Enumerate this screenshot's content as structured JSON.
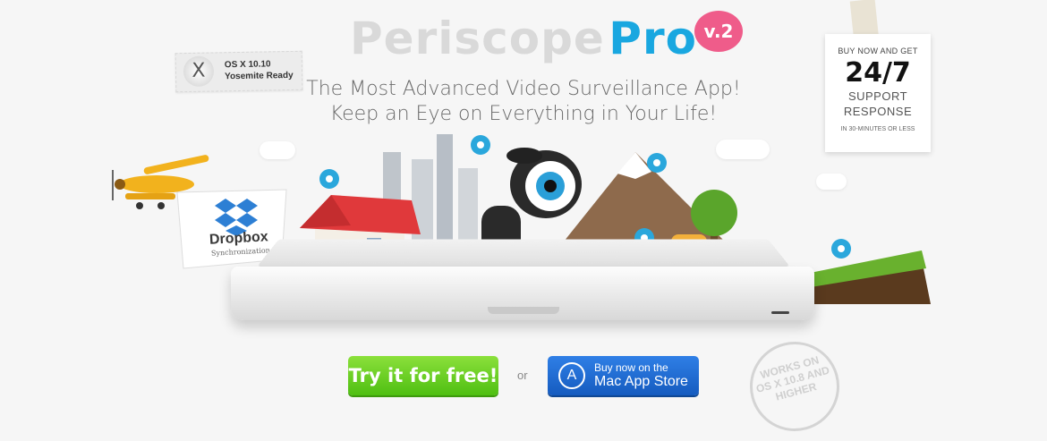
{
  "hero": {
    "title_part1": "Periscope",
    "title_part2": "Pro",
    "version_badge": "v.2",
    "subtitle_line1": "The Most Advanced Video Surveillance App!",
    "subtitle_line2": "Keep an Eye on Everything in Your Life!"
  },
  "osx_badge": {
    "icon": "x-icon",
    "line1": "OS X 10.10",
    "line2": "Yosemite Ready"
  },
  "support_note": {
    "line1": "BUY NOW AND GET",
    "big": "24/7",
    "line3": "SUPPORT",
    "line4": "RESPONSE",
    "small": "IN 30-MINUTES OR LESS"
  },
  "dropbox_flag": {
    "title": "Dropbox",
    "subtitle": "Synchronization"
  },
  "cta": {
    "try_label": "Try it for free!",
    "or_label": "or",
    "store_line1": "Buy now on the",
    "store_line2": "Mac App Store"
  },
  "stamp": {
    "line1": "WORKS ON",
    "line2": "OS X 10.8 AND",
    "line3": "HIGHER"
  },
  "colors": {
    "accent_blue": "#19a7e0",
    "badge_pink": "#ef5c8a",
    "green_button": "#5cc61a",
    "store_blue": "#1f6fd6"
  }
}
